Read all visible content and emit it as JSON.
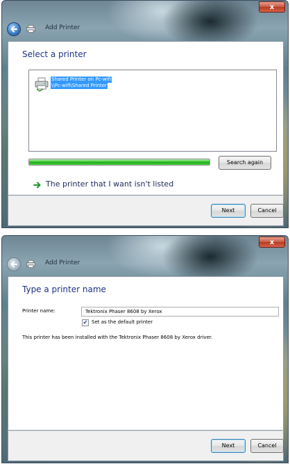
{
  "window1": {
    "close_glyph": "x",
    "wizard_title": "Add Printer",
    "heading": "Select a printer",
    "printer": {
      "line1": "Shared Printer on Pc-wifi",
      "line2": "\\\\Pc-wifi\\Shared Printer"
    },
    "progress": 1.0,
    "search_again_label": "Search again",
    "not_listed_label": "The printer that I want isn't listed",
    "next_label": "Next",
    "cancel_label": "Cancel"
  },
  "window2": {
    "close_glyph": "x",
    "wizard_title": "Add Printer",
    "heading": "Type a printer name",
    "printer_name_label": "Printer name:",
    "printer_name_value": "Tektronix Phaser 8608 by Xerox",
    "default_checkbox_label": "Set as the default printer",
    "default_checked": true,
    "installed_message": "This printer has been installed with the Tektronix Phaser 8608 by Xerox driver.",
    "next_label": "Next",
    "cancel_label": "Cancel"
  },
  "colors": {
    "accent_blue": "#3399ff",
    "heading_blue": "#1e3287",
    "progress_green": "#37c62e",
    "close_red": "#c75a45"
  }
}
